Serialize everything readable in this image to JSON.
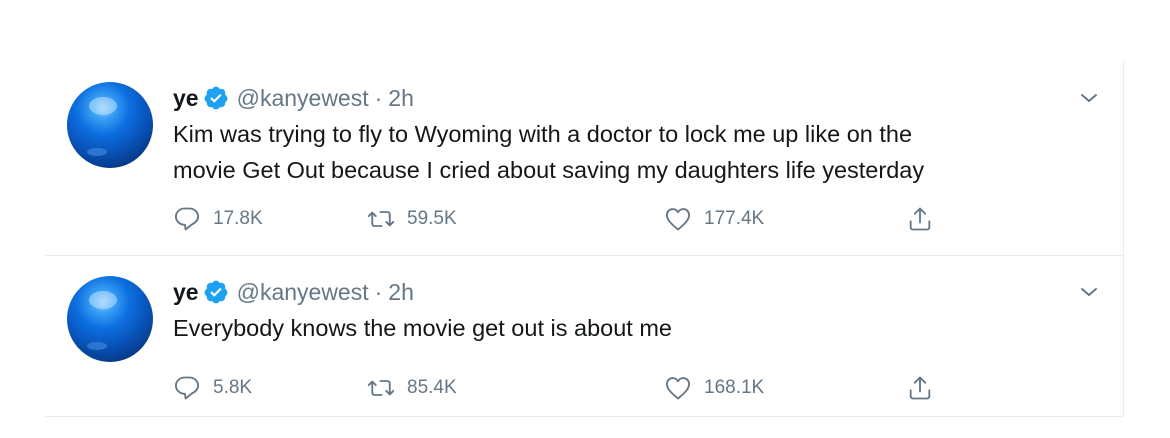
{
  "tweets": [
    {
      "name": "ye",
      "handle": "@kanyewest",
      "separator": "·",
      "time": "2h",
      "text_lines": [
        "Kim was trying to fly to Wyoming with a doctor to lock me up like on the",
        "movie Get Out because I cried about saving my daughters life yesterday"
      ],
      "replies": "17.8K",
      "retweets": "59.5K",
      "likes": "177.4K"
    },
    {
      "name": "ye",
      "handle": "@kanyewest",
      "separator": "·",
      "time": "2h",
      "text_lines": [
        "Everybody knows the movie get out is about me"
      ],
      "replies": "5.8K",
      "retweets": "85.4K",
      "likes": "168.1K"
    }
  ],
  "icons": {
    "verified": "verified-badge-icon",
    "caret": "chevron-down-icon",
    "reply": "reply-bubble-icon",
    "retweet": "retweet-icon",
    "like": "heart-icon",
    "share": "share-upload-icon"
  },
  "colors": {
    "verified_blue": "#1da1f2",
    "text_primary": "#14171a",
    "text_secondary": "#657786",
    "divider": "#e6ecf0"
  }
}
